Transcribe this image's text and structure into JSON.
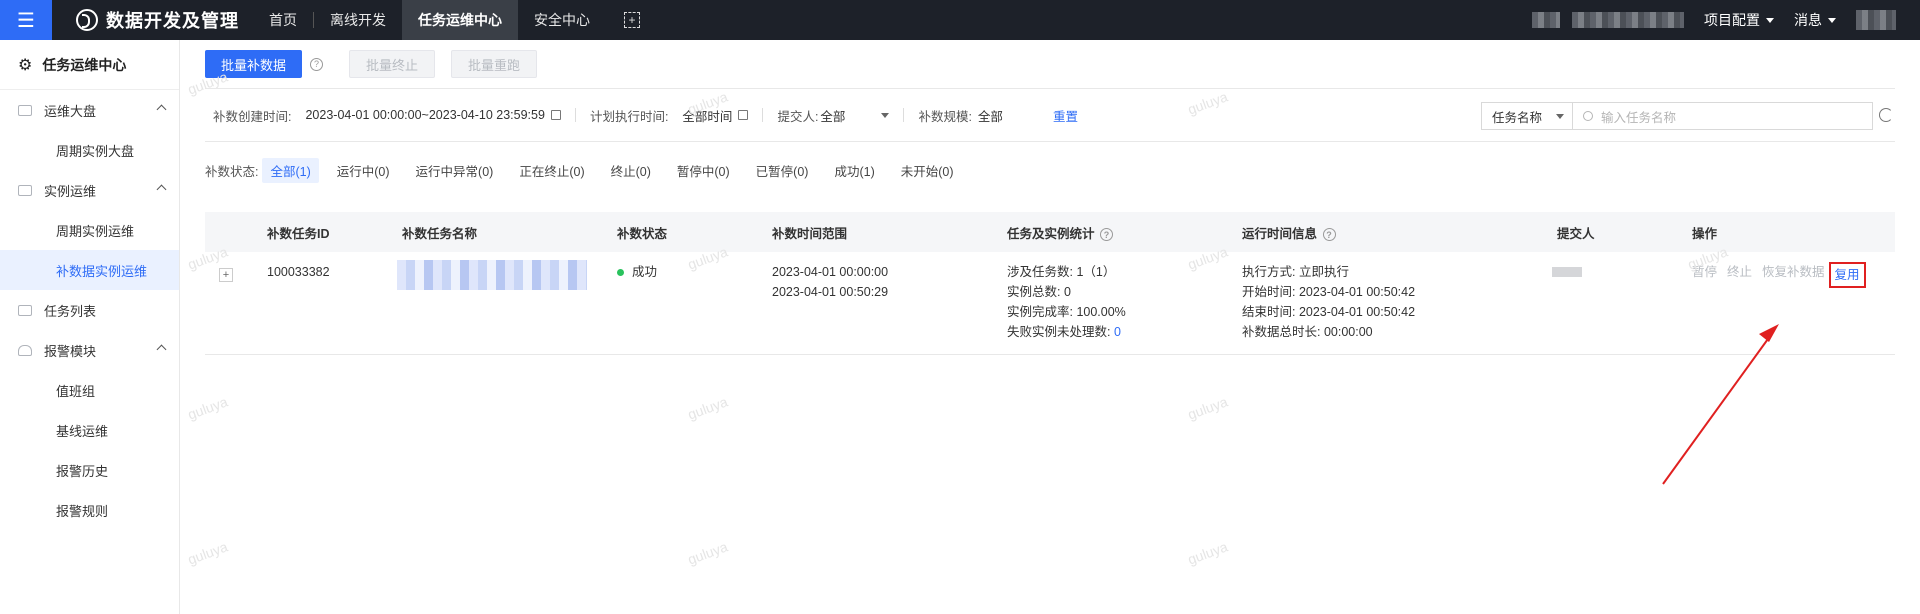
{
  "topbar": {
    "app_title": "数据开发及管理",
    "nav": [
      "首页",
      "离线开发",
      "任务运维中心",
      "安全中心"
    ],
    "project_menu": "项目配置",
    "message_menu": "消息"
  },
  "sidebar": {
    "title": "任务运维中心",
    "groups": [
      {
        "label": "运维大盘",
        "items": [
          "周期实例大盘"
        ]
      },
      {
        "label": "实例运维",
        "items": [
          "周期实例运维",
          "补数据实例运维"
        ]
      },
      {
        "label": "任务列表",
        "items": []
      },
      {
        "label": "报警模块",
        "items": [
          "值班组",
          "基线运维",
          "报警历史",
          "报警规则"
        ]
      }
    ]
  },
  "toolbar": {
    "batch_backfill": "批量补数据",
    "batch_stop": "批量终止",
    "batch_rerun": "批量重跑"
  },
  "filters": {
    "create_time_label": "补数创建时间:",
    "create_time_value": "2023-04-01 00:00:00~2023-04-10 23:59:59",
    "plan_time_label": "计划执行时间:",
    "plan_time_value": "全部时间",
    "submitter_label": "提交人:",
    "submitter_value": "全部",
    "scale_label": "补数规模:",
    "scale_value": "全部",
    "reset": "重置",
    "search_type": "任务名称",
    "search_placeholder": "输入任务名称"
  },
  "status_filter": {
    "label": "补数状态:",
    "items": [
      "全部(1)",
      "运行中(0)",
      "运行中异常(0)",
      "正在终止(0)",
      "终止(0)",
      "暂停中(0)",
      "已暂停(0)",
      "成功(1)",
      "未开始(0)"
    ]
  },
  "table": {
    "headers": [
      "补数任务ID",
      "补数任务名称",
      "补数状态",
      "补数时间范围",
      "任务及实例统计",
      "运行时间信息",
      "提交人",
      "操作"
    ],
    "row": {
      "id": "100033382",
      "status": "成功",
      "range_start": "2023-04-01 00:00:00",
      "range_end": "2023-04-01 00:50:29",
      "stat_tasks": "涉及任务数: 1（1）",
      "stat_instances": "实例总数: 0",
      "stat_rate": "实例完成率: 100.00%",
      "stat_failed_label": "失败实例未处理数:",
      "stat_failed_value": "0",
      "run_mode": "执行方式: 立即执行",
      "run_start": "开始时间: 2023-04-01 00:50:42",
      "run_end": "结束时间: 2023-04-01 00:50:42",
      "run_duration": "补数据总时长: 00:00:00",
      "ops": [
        "暂停",
        "终止",
        "恢复补数据",
        "复用"
      ]
    }
  },
  "watermark_text": "guluya",
  "colors": {
    "accent": "#2e6cf6",
    "success": "#29c25d",
    "highlight": "#e02020",
    "topbar": "#1d2129"
  }
}
